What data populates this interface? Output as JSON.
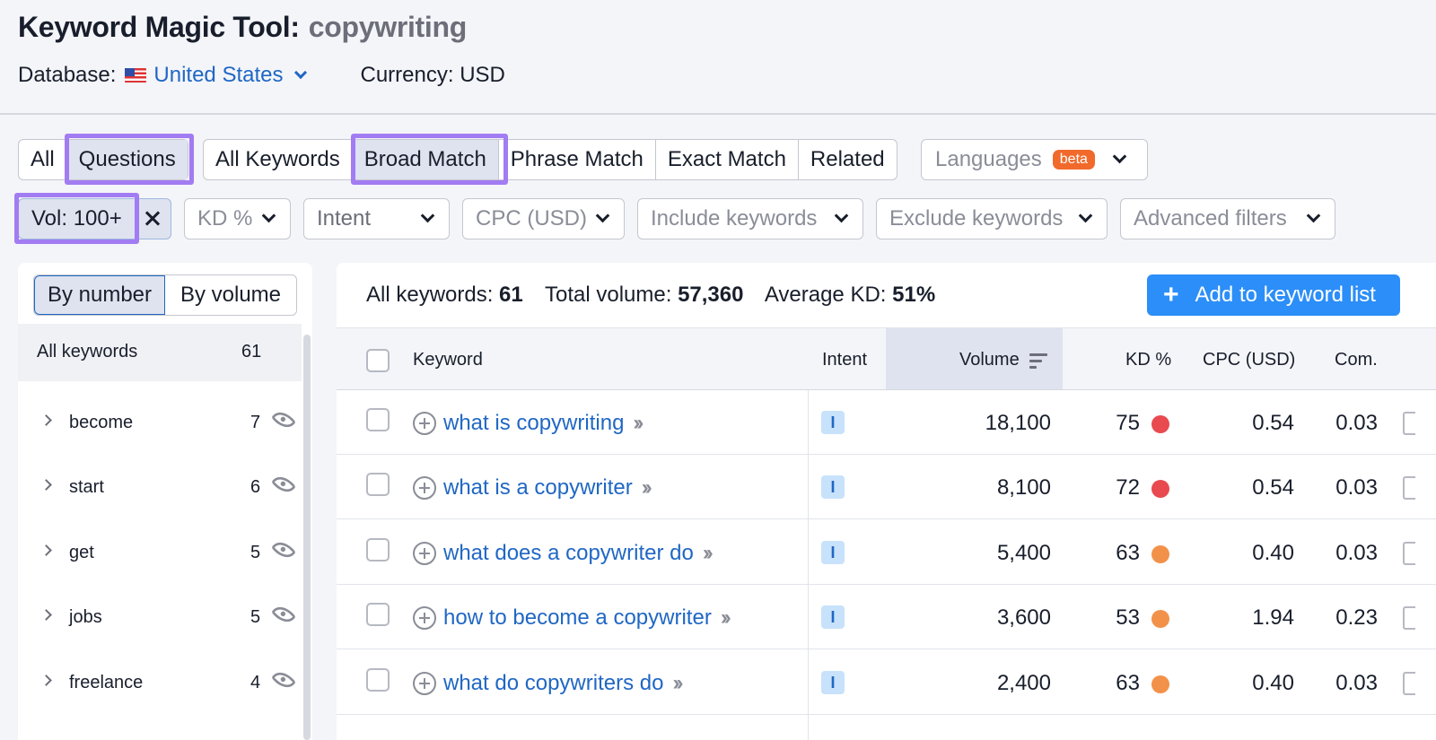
{
  "header": {
    "title": "Keyword Magic Tool:",
    "query": "copywriting",
    "database_label": "Database:",
    "database_value": "United States",
    "currency": "Currency: USD"
  },
  "tabs": {
    "question_filter": [
      "All",
      "Questions"
    ],
    "match_types": [
      "All Keywords",
      "Broad Match",
      "Phrase Match",
      "Exact Match",
      "Related"
    ],
    "languages": "Languages",
    "beta": "beta"
  },
  "filters": {
    "volume": "Vol: 100+",
    "kd": "KD %",
    "intent": "Intent",
    "cpc": "CPC (USD)",
    "include": "Include keywords",
    "exclude": "Exclude keywords",
    "advanced": "Advanced filters"
  },
  "sidebar": {
    "toggle": [
      "By number",
      "By volume"
    ],
    "all": {
      "label": "All keywords",
      "count": "61"
    },
    "groups": [
      {
        "label": "become",
        "count": "7"
      },
      {
        "label": "start",
        "count": "6"
      },
      {
        "label": "get",
        "count": "5"
      },
      {
        "label": "jobs",
        "count": "5"
      },
      {
        "label": "freelance",
        "count": "4"
      }
    ]
  },
  "summary": {
    "all_keywords_label": "All keywords:",
    "all_keywords_value": "61",
    "total_volume_label": "Total volume:",
    "total_volume_value": "57,360",
    "avg_kd_label": "Average KD:",
    "avg_kd_value": "51%",
    "add_button": "Add to keyword list"
  },
  "table": {
    "columns": [
      "Keyword",
      "Intent",
      "Volume",
      "KD %",
      "CPC (USD)",
      "Com."
    ],
    "rows": [
      {
        "keyword": "what is copywriting",
        "intent": "I",
        "volume": "18,100",
        "kd": "75",
        "kd_color": "#e84a4f",
        "cpc": "0.54",
        "com": "0.03"
      },
      {
        "keyword": "what is a copywriter",
        "intent": "I",
        "volume": "8,100",
        "kd": "72",
        "kd_color": "#e84a4f",
        "cpc": "0.54",
        "com": "0.03"
      },
      {
        "keyword": "what does a copywriter do",
        "intent": "I",
        "volume": "5,400",
        "kd": "63",
        "kd_color": "#f2924a",
        "cpc": "0.40",
        "com": "0.03"
      },
      {
        "keyword": "how to become a copywriter",
        "intent": "I",
        "volume": "3,600",
        "kd": "53",
        "kd_color": "#f2924a",
        "cpc": "1.94",
        "com": "0.23"
      },
      {
        "keyword": "what do copywriters do",
        "intent": "I",
        "volume": "2,400",
        "kd": "63",
        "kd_color": "#f2924a",
        "cpc": "0.40",
        "com": "0.03"
      }
    ]
  },
  "colors": {
    "accent": "#2c8ef8",
    "link": "#2067c4",
    "highlight": "#a27cf2"
  }
}
